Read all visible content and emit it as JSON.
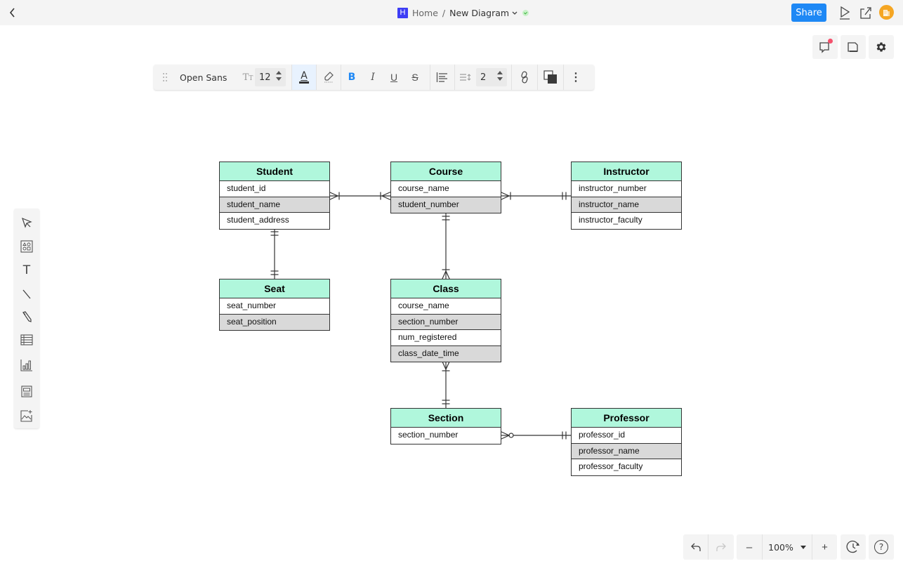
{
  "topbar": {
    "brand_letter": "H",
    "breadcrumb_home": "Home",
    "breadcrumb_separator": "/",
    "document_title": "New Diagram",
    "share_label": "Share",
    "brand_color": "#3d3df5",
    "share_color": "#1e88f5",
    "avatar_color": "#f5a623"
  },
  "format_toolbar": {
    "font_family": "Open Sans",
    "size_icon": "TT",
    "font_size": "12",
    "font_color_glyph": "A",
    "bold_glyph": "B",
    "italic_glyph": "I",
    "underline_glyph": "U",
    "strike_glyph": "S",
    "line_spacing": "2",
    "more_glyph": "⋮"
  },
  "left_tools": [
    {
      "name": "select"
    },
    {
      "name": "shapes"
    },
    {
      "name": "text",
      "glyph": "T"
    },
    {
      "name": "line"
    },
    {
      "name": "pencil"
    },
    {
      "name": "table"
    },
    {
      "name": "chart"
    },
    {
      "name": "frame"
    },
    {
      "name": "image"
    }
  ],
  "diagram": {
    "header_color": "#b0f7dc",
    "alt_row_color": "#d9d9d9",
    "entities": {
      "student": {
        "title": "Student",
        "fields": [
          "student_id",
          "student_name",
          "student_address"
        ]
      },
      "course": {
        "title": "Course",
        "fields": [
          "course_name",
          "student_number"
        ]
      },
      "instructor": {
        "title": "Instructor",
        "fields": [
          "instructor_number",
          "instructor_name",
          "instructor_faculty"
        ]
      },
      "seat": {
        "title": "Seat",
        "fields": [
          "seat_number",
          "seat_position"
        ]
      },
      "class": {
        "title": "Class",
        "fields": [
          "course_name",
          "section_number",
          "num_registered",
          "class_date_time"
        ]
      },
      "section": {
        "title": "Section",
        "fields": [
          "section_number"
        ]
      },
      "professor": {
        "title": "Professor",
        "fields": [
          "professor_id",
          "professor_name",
          "professor_faculty"
        ]
      }
    },
    "relationships": [
      {
        "from": "Student",
        "to": "Course",
        "from_cardinality": "one-or-many",
        "to_cardinality": "one-or-many"
      },
      {
        "from": "Course",
        "to": "Instructor",
        "from_cardinality": "one-or-many",
        "to_cardinality": "one-and-only-one"
      },
      {
        "from": "Student",
        "to": "Seat",
        "from_cardinality": "one-and-only-one",
        "to_cardinality": "one-and-only-one"
      },
      {
        "from": "Course",
        "to": "Class",
        "from_cardinality": "one-and-only-one",
        "to_cardinality": "one-or-many"
      },
      {
        "from": "Class",
        "to": "Section",
        "from_cardinality": "one-or-many",
        "to_cardinality": "one-and-only-one"
      },
      {
        "from": "Section",
        "to": "Professor",
        "from_cardinality": "zero-or-many",
        "to_cardinality": "one-and-only-one"
      }
    ]
  },
  "bottom_bar": {
    "zoom_level": "100%",
    "zoom_out_glyph": "–",
    "zoom_in_glyph": "+",
    "help_glyph": "?"
  }
}
